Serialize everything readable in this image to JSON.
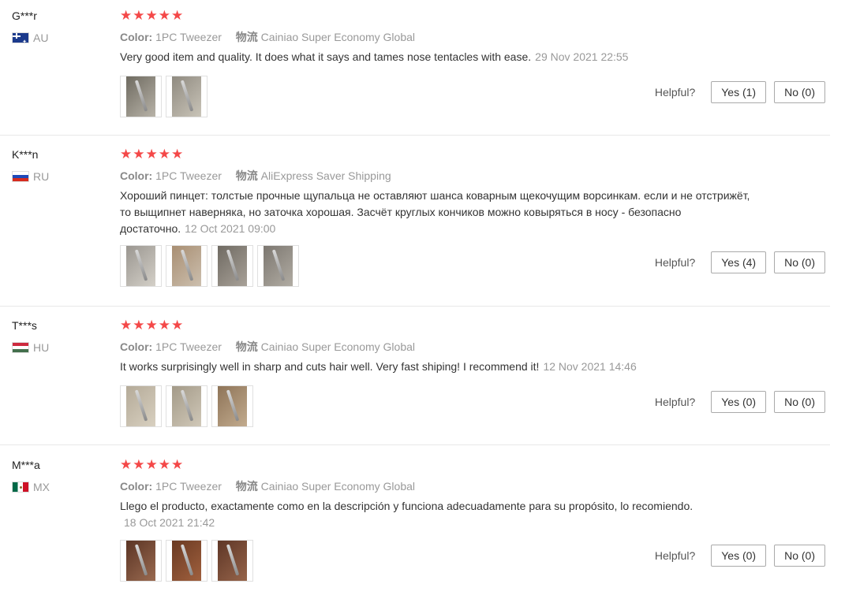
{
  "colors": {
    "star": "#f44848",
    "divider": "#e8e8e8",
    "muted": "#999999"
  },
  "labels": {
    "color": "Color:",
    "shipping_icon": "物流",
    "helpful": "Helpful?"
  },
  "reviews": [
    {
      "user": "G***r",
      "country": "AU",
      "rating": 5,
      "color_value": "1PC Tweezer",
      "shipping": "Cainiao Super Economy Global",
      "text": "Very good item and quality. It does what it says and tames nose tentacles with ease.",
      "date": "29 Nov 2021 22:55",
      "photo_count": 2,
      "yes": "Yes (1)",
      "no": "No (0)"
    },
    {
      "user": "K***n",
      "country": "RU",
      "rating": 5,
      "color_value": "1PC Tweezer",
      "shipping": "AliExpress Saver Shipping",
      "text": "Хороший пинцет: толстые прочные щупальца не оставляют шанса коварным щекочущим ворсинкам. если и не отстрижёт, то выщипнет наверняка, но заточка хорошая. Засчёт круглых кончиков можно ковыряться в носу - безопасно достаточно.",
      "date": "12 Oct 2021 09:00",
      "photo_count": 4,
      "yes": "Yes (4)",
      "no": "No (0)"
    },
    {
      "user": "T***s",
      "country": "HU",
      "rating": 5,
      "color_value": "1PC Tweezer",
      "shipping": "Cainiao Super Economy Global",
      "text": "It works surprisingly well in sharp and cuts hair well. Very fast shiping! I recommend it!",
      "date": "12 Nov 2021 14:46",
      "photo_count": 3,
      "yes": "Yes (0)",
      "no": "No (0)"
    },
    {
      "user": "M***a",
      "country": "MX",
      "rating": 5,
      "color_value": "1PC Tweezer",
      "shipping": "Cainiao Super Economy Global",
      "text": "Llego el producto, exactamente como en la descripción y funciona adecuadamente para su propósito, lo recomiendo.",
      "date": "18 Oct 2021 21:42",
      "photo_count": 3,
      "yes": "Yes (0)",
      "no": "No (0)"
    }
  ]
}
